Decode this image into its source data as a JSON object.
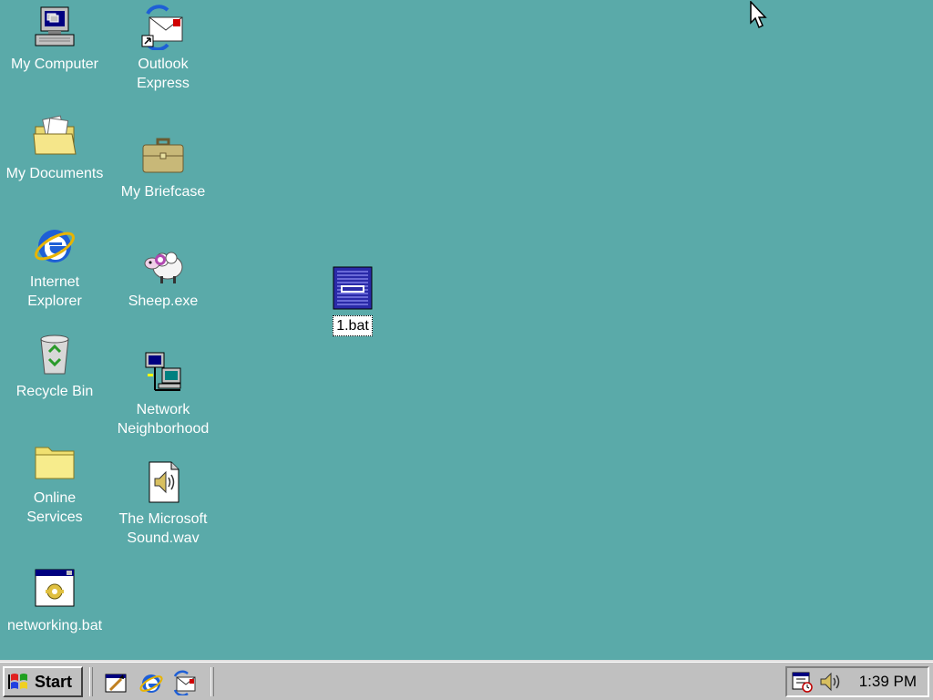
{
  "desktop": {
    "background_color": "#5aaaa9",
    "icons": [
      {
        "id": "my-computer",
        "label": "My Computer",
        "icon": "computer-icon"
      },
      {
        "id": "outlook-express",
        "label": "Outlook\nExpress",
        "icon": "outlook-express-icon"
      },
      {
        "id": "my-documents",
        "label": "My Documents",
        "icon": "documents-folder-icon"
      },
      {
        "id": "my-briefcase",
        "label": "My Briefcase",
        "icon": "briefcase-icon"
      },
      {
        "id": "internet-explorer",
        "label": "Internet\nExplorer",
        "icon": "internet-explorer-icon"
      },
      {
        "id": "sheep-exe",
        "label": "Sheep.exe",
        "icon": "sheep-icon"
      },
      {
        "id": "recycle-bin",
        "label": "Recycle Bin",
        "icon": "recycle-bin-icon"
      },
      {
        "id": "network-neighborhood",
        "label": "Network\nNeighborhood",
        "icon": "network-icon"
      },
      {
        "id": "online-services",
        "label": "Online\nServices",
        "icon": "folder-icon"
      },
      {
        "id": "microsoft-sound",
        "label": "The Microsoft\nSound.wav",
        "icon": "sound-file-icon"
      },
      {
        "id": "networking-bat",
        "label": "networking.bat",
        "icon": "batch-file-icon"
      },
      {
        "id": "one-bat",
        "label": "1.bat",
        "icon": "dos-file-icon",
        "selected": true
      }
    ]
  },
  "taskbar": {
    "start_label": "Start",
    "quick_launch": [
      "show-desktop-icon",
      "internet-explorer-icon",
      "outlook-express-icon"
    ],
    "tray": {
      "icons": [
        "scheduler-icon",
        "volume-icon"
      ],
      "clock": "1:39 PM"
    }
  }
}
